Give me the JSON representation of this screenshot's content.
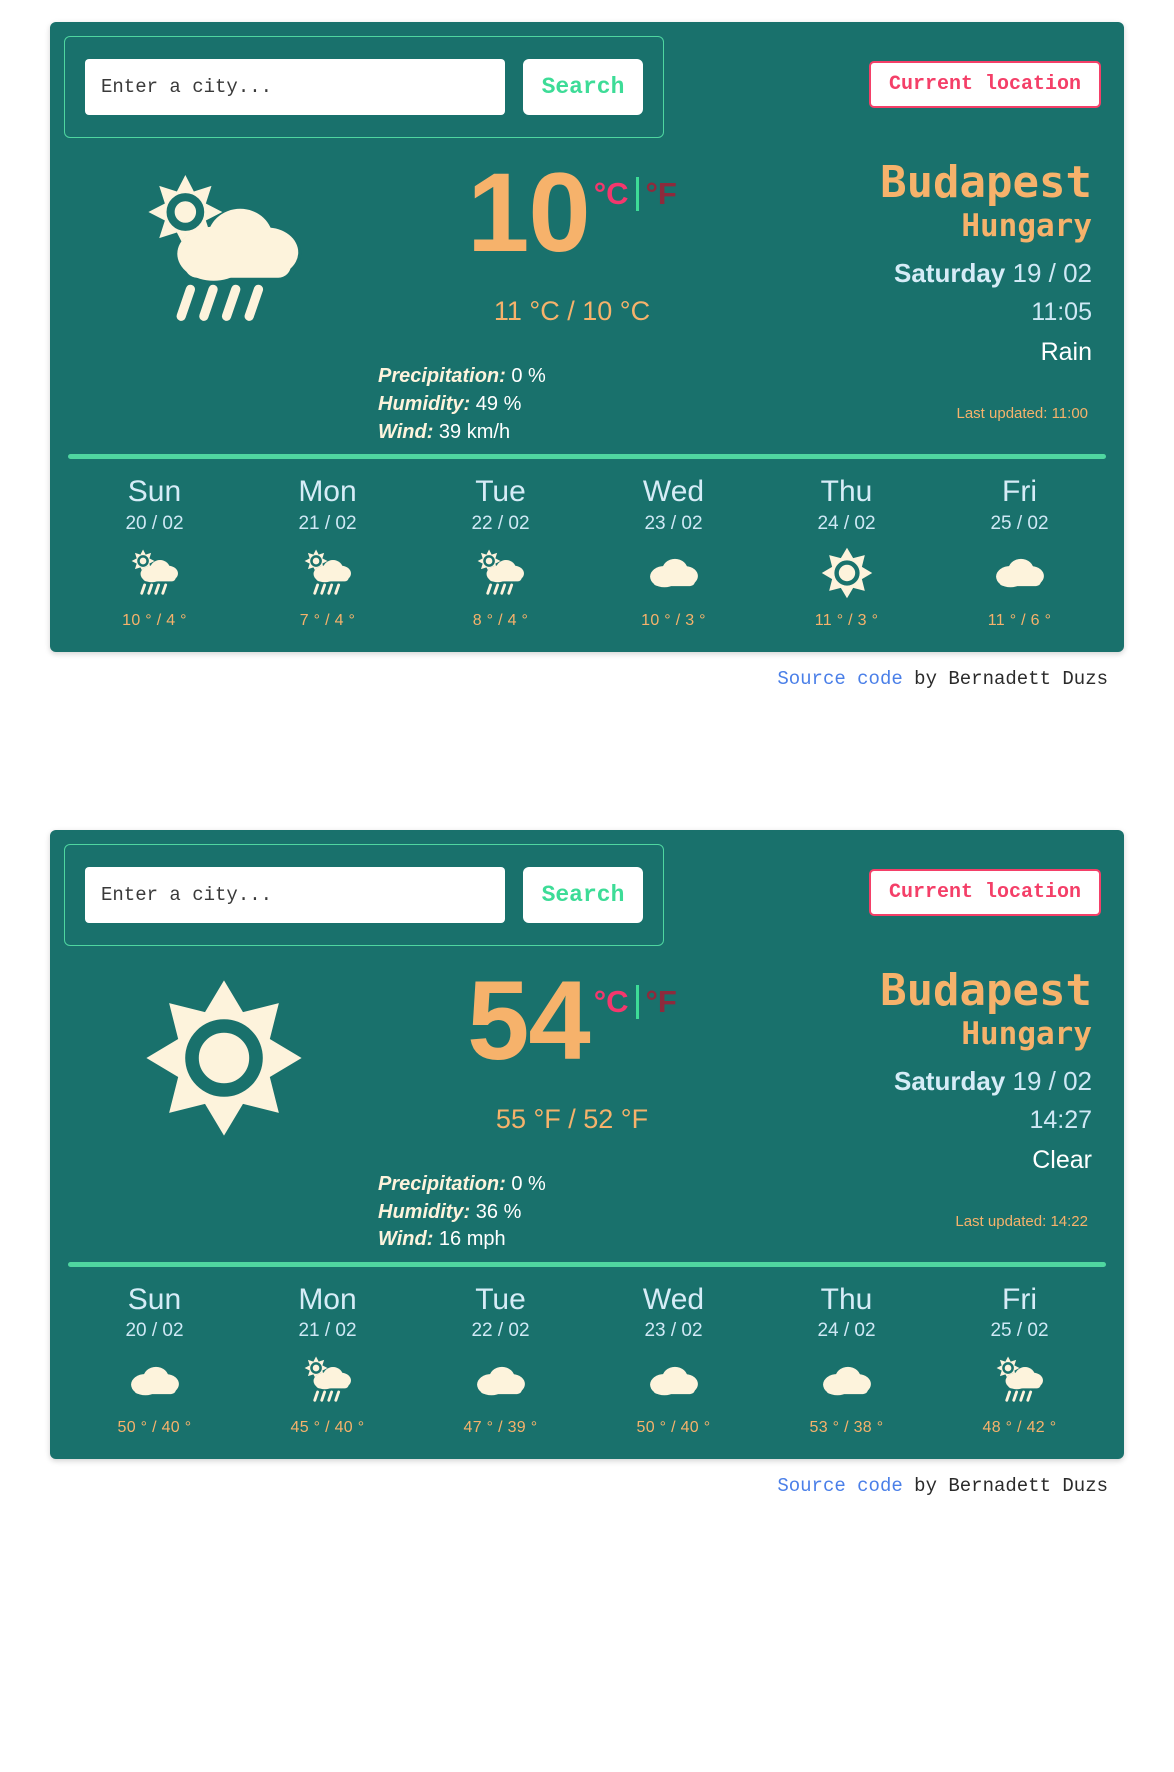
{
  "colors": {
    "panel_bg": "#19716c",
    "accent_orange": "#f6b26b",
    "accent_green": "#3ddc97",
    "accent_pink": "#f43f68",
    "divider_green": "#4fd6a0",
    "cream": "#fdf3dc",
    "light_blue": "#cfe8f5",
    "unit_active": "#f4376d",
    "unit_inactive": "#8e2a3c",
    "link_blue": "#4a7fe8"
  },
  "search": {
    "placeholder": "Enter a city...",
    "value": "",
    "search_label": "Search",
    "current_location_label": "Current location"
  },
  "footer": {
    "link_label": "Source code",
    "rest": " by Bernadett Duzs"
  },
  "labels": {
    "precipitation": "Precipitation:",
    "humidity": "Humidity:",
    "wind": "Wind:",
    "last_updated_prefix": "Last updated:"
  },
  "panels": [
    {
      "icon": "sun-cloud-rain-icon",
      "temperature": "10",
      "unit_c": "°C",
      "unit_f": "°F",
      "minmax": "11 °C / 10 °C",
      "precipitation": "0 %",
      "humidity": "49 %",
      "wind": "39 km/h",
      "city": "Budapest",
      "country": "Hungary",
      "day_of_week": "Saturday",
      "date": "19 / 02",
      "time": "11:05",
      "condition": "Rain",
      "last_updated": "Last updated: 11:00",
      "forecast": [
        {
          "day": "Sun",
          "date": "20 / 02",
          "icon": "sun-cloud-rain-icon",
          "temps": "10 ° / 4 °"
        },
        {
          "day": "Mon",
          "date": "21 / 02",
          "icon": "sun-cloud-rain-icon",
          "temps": "7 ° / 4 °"
        },
        {
          "day": "Tue",
          "date": "22 / 02",
          "icon": "sun-cloud-rain-icon",
          "temps": "8 ° / 4 °"
        },
        {
          "day": "Wed",
          "date": "23 / 02",
          "icon": "cloud-icon",
          "temps": "10 ° / 3 °"
        },
        {
          "day": "Thu",
          "date": "24 / 02",
          "icon": "sun-icon",
          "temps": "11 ° / 3 °"
        },
        {
          "day": "Fri",
          "date": "25 / 02",
          "icon": "cloud-icon",
          "temps": "11 ° / 6 °"
        }
      ]
    },
    {
      "icon": "sun-icon",
      "temperature": "54",
      "unit_c": "°C",
      "unit_f": "°F",
      "minmax": "55 °F / 52 °F",
      "precipitation": "0 %",
      "humidity": "36 %",
      "wind": "16 mph",
      "city": "Budapest",
      "country": "Hungary",
      "day_of_week": "Saturday",
      "date": "19 / 02",
      "time": "14:27",
      "condition": "Clear",
      "last_updated": "Last updated: 14:22",
      "forecast": [
        {
          "day": "Sun",
          "date": "20 / 02",
          "icon": "cloud-icon",
          "temps": "50 ° / 40 °"
        },
        {
          "day": "Mon",
          "date": "21 / 02",
          "icon": "sun-cloud-rain-icon",
          "temps": "45 ° / 40 °"
        },
        {
          "day": "Tue",
          "date": "22 / 02",
          "icon": "cloud-icon",
          "temps": "47 ° / 39 °"
        },
        {
          "day": "Wed",
          "date": "23 / 02",
          "icon": "cloud-icon",
          "temps": "50 ° / 40 °"
        },
        {
          "day": "Thu",
          "date": "24 / 02",
          "icon": "cloud-icon",
          "temps": "53 ° / 38 °"
        },
        {
          "day": "Fri",
          "date": "25 / 02",
          "icon": "sun-cloud-rain-icon",
          "temps": "48 ° / 42 °"
        }
      ]
    }
  ]
}
